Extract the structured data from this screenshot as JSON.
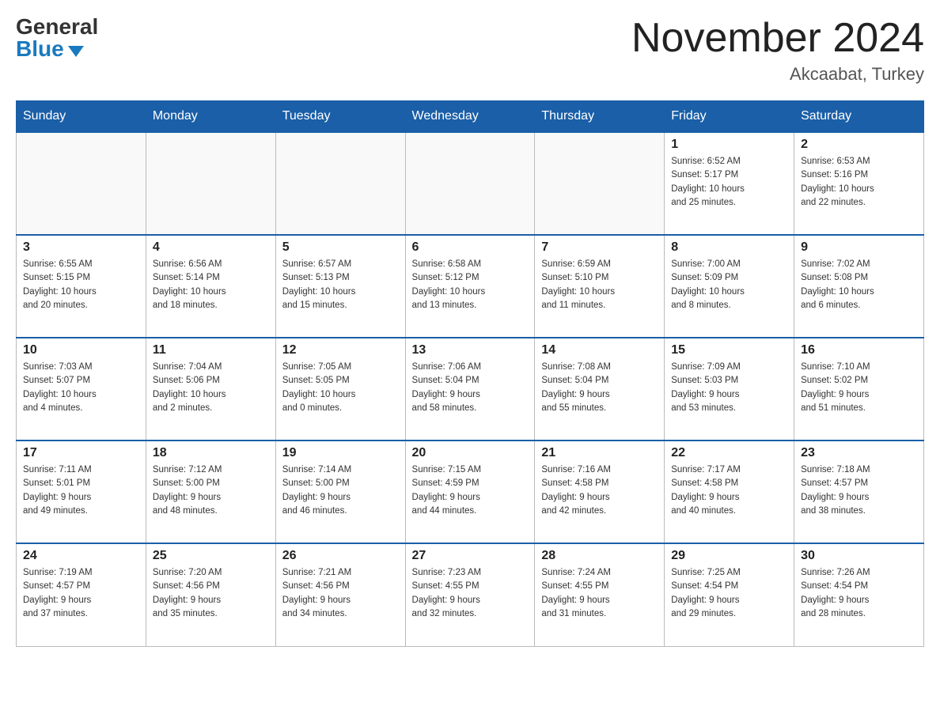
{
  "header": {
    "logo_general": "General",
    "logo_blue": "Blue",
    "month_title": "November 2024",
    "location": "Akcaabat, Turkey"
  },
  "weekdays": [
    "Sunday",
    "Monday",
    "Tuesday",
    "Wednesday",
    "Thursday",
    "Friday",
    "Saturday"
  ],
  "weeks": [
    [
      {
        "day": "",
        "info": ""
      },
      {
        "day": "",
        "info": ""
      },
      {
        "day": "",
        "info": ""
      },
      {
        "day": "",
        "info": ""
      },
      {
        "day": "",
        "info": ""
      },
      {
        "day": "1",
        "info": "Sunrise: 6:52 AM\nSunset: 5:17 PM\nDaylight: 10 hours\nand 25 minutes."
      },
      {
        "day": "2",
        "info": "Sunrise: 6:53 AM\nSunset: 5:16 PM\nDaylight: 10 hours\nand 22 minutes."
      }
    ],
    [
      {
        "day": "3",
        "info": "Sunrise: 6:55 AM\nSunset: 5:15 PM\nDaylight: 10 hours\nand 20 minutes."
      },
      {
        "day": "4",
        "info": "Sunrise: 6:56 AM\nSunset: 5:14 PM\nDaylight: 10 hours\nand 18 minutes."
      },
      {
        "day": "5",
        "info": "Sunrise: 6:57 AM\nSunset: 5:13 PM\nDaylight: 10 hours\nand 15 minutes."
      },
      {
        "day": "6",
        "info": "Sunrise: 6:58 AM\nSunset: 5:12 PM\nDaylight: 10 hours\nand 13 minutes."
      },
      {
        "day": "7",
        "info": "Sunrise: 6:59 AM\nSunset: 5:10 PM\nDaylight: 10 hours\nand 11 minutes."
      },
      {
        "day": "8",
        "info": "Sunrise: 7:00 AM\nSunset: 5:09 PM\nDaylight: 10 hours\nand 8 minutes."
      },
      {
        "day": "9",
        "info": "Sunrise: 7:02 AM\nSunset: 5:08 PM\nDaylight: 10 hours\nand 6 minutes."
      }
    ],
    [
      {
        "day": "10",
        "info": "Sunrise: 7:03 AM\nSunset: 5:07 PM\nDaylight: 10 hours\nand 4 minutes."
      },
      {
        "day": "11",
        "info": "Sunrise: 7:04 AM\nSunset: 5:06 PM\nDaylight: 10 hours\nand 2 minutes."
      },
      {
        "day": "12",
        "info": "Sunrise: 7:05 AM\nSunset: 5:05 PM\nDaylight: 10 hours\nand 0 minutes."
      },
      {
        "day": "13",
        "info": "Sunrise: 7:06 AM\nSunset: 5:04 PM\nDaylight: 9 hours\nand 58 minutes."
      },
      {
        "day": "14",
        "info": "Sunrise: 7:08 AM\nSunset: 5:04 PM\nDaylight: 9 hours\nand 55 minutes."
      },
      {
        "day": "15",
        "info": "Sunrise: 7:09 AM\nSunset: 5:03 PM\nDaylight: 9 hours\nand 53 minutes."
      },
      {
        "day": "16",
        "info": "Sunrise: 7:10 AM\nSunset: 5:02 PM\nDaylight: 9 hours\nand 51 minutes."
      }
    ],
    [
      {
        "day": "17",
        "info": "Sunrise: 7:11 AM\nSunset: 5:01 PM\nDaylight: 9 hours\nand 49 minutes."
      },
      {
        "day": "18",
        "info": "Sunrise: 7:12 AM\nSunset: 5:00 PM\nDaylight: 9 hours\nand 48 minutes."
      },
      {
        "day": "19",
        "info": "Sunrise: 7:14 AM\nSunset: 5:00 PM\nDaylight: 9 hours\nand 46 minutes."
      },
      {
        "day": "20",
        "info": "Sunrise: 7:15 AM\nSunset: 4:59 PM\nDaylight: 9 hours\nand 44 minutes."
      },
      {
        "day": "21",
        "info": "Sunrise: 7:16 AM\nSunset: 4:58 PM\nDaylight: 9 hours\nand 42 minutes."
      },
      {
        "day": "22",
        "info": "Sunrise: 7:17 AM\nSunset: 4:58 PM\nDaylight: 9 hours\nand 40 minutes."
      },
      {
        "day": "23",
        "info": "Sunrise: 7:18 AM\nSunset: 4:57 PM\nDaylight: 9 hours\nand 38 minutes."
      }
    ],
    [
      {
        "day": "24",
        "info": "Sunrise: 7:19 AM\nSunset: 4:57 PM\nDaylight: 9 hours\nand 37 minutes."
      },
      {
        "day": "25",
        "info": "Sunrise: 7:20 AM\nSunset: 4:56 PM\nDaylight: 9 hours\nand 35 minutes."
      },
      {
        "day": "26",
        "info": "Sunrise: 7:21 AM\nSunset: 4:56 PM\nDaylight: 9 hours\nand 34 minutes."
      },
      {
        "day": "27",
        "info": "Sunrise: 7:23 AM\nSunset: 4:55 PM\nDaylight: 9 hours\nand 32 minutes."
      },
      {
        "day": "28",
        "info": "Sunrise: 7:24 AM\nSunset: 4:55 PM\nDaylight: 9 hours\nand 31 minutes."
      },
      {
        "day": "29",
        "info": "Sunrise: 7:25 AM\nSunset: 4:54 PM\nDaylight: 9 hours\nand 29 minutes."
      },
      {
        "day": "30",
        "info": "Sunrise: 7:26 AM\nSunset: 4:54 PM\nDaylight: 9 hours\nand 28 minutes."
      }
    ]
  ]
}
